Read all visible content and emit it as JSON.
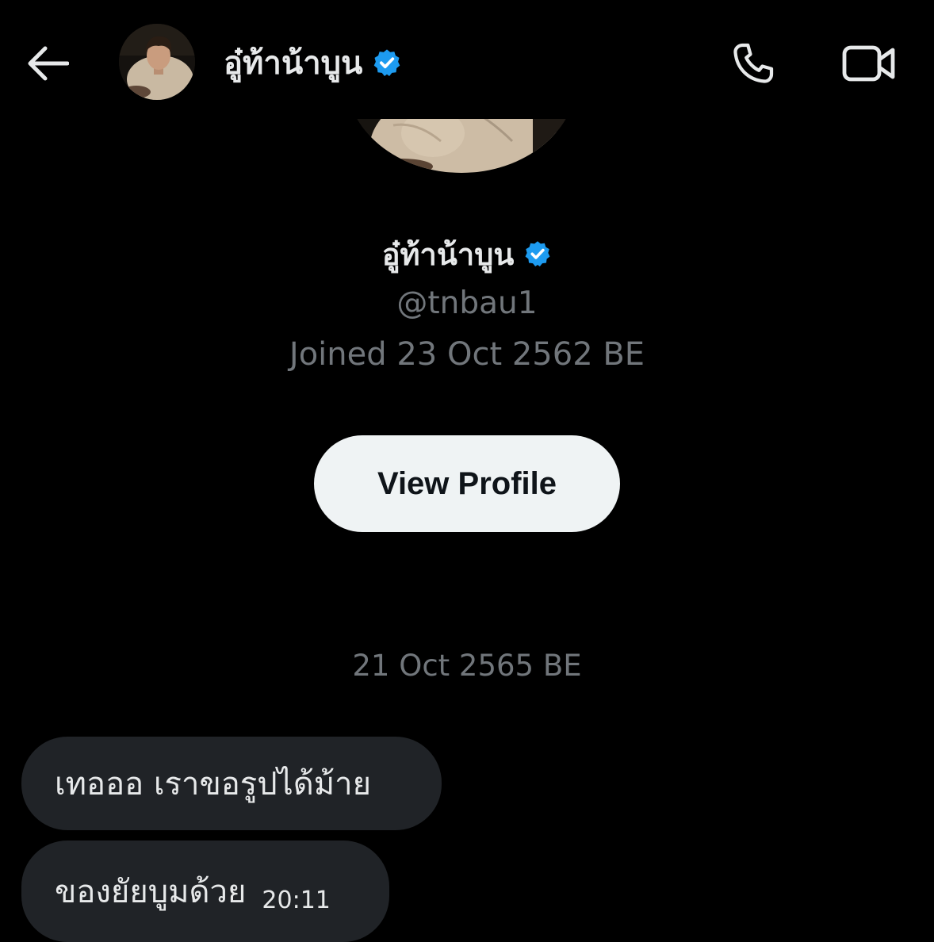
{
  "header": {
    "name": "อู๋ท้าน้าบูน",
    "verified": true,
    "back_icon": "arrow-left-icon",
    "call_icon": "phone-icon",
    "video_icon": "video-camera-icon"
  },
  "profile": {
    "name": "อู๋ท้าน้าบูน",
    "handle": "@tnbau1",
    "joined": "Joined 23 Oct 2562 BE",
    "view_profile_label": "View Profile"
  },
  "conversation": {
    "date_separator": "21 Oct 2565 BE",
    "messages": [
      {
        "text": "เทอออ เราขอรูปได้ม้าย",
        "time": ""
      },
      {
        "text": "ของยัยบูมด้วย",
        "time": "20:11"
      }
    ]
  },
  "colors": {
    "background": "#000000",
    "primary_text": "#e7e9ea",
    "secondary_text": "#71767b",
    "verified_blue": "#1d9bf0",
    "bubble_bg": "#202327",
    "button_bg": "#eff3f4",
    "button_text": "#0f1419"
  }
}
